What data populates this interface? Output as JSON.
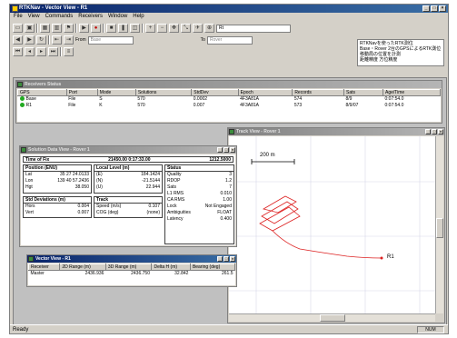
{
  "app": {
    "title": "RTKNav - Vector View - R1",
    "menu": [
      "File",
      "View",
      "Commands",
      "Receivers",
      "Window",
      "Help"
    ],
    "tb_combo": "Rt",
    "from_label": "From",
    "from_value": "Base",
    "to_label": "To",
    "to_value": "Rover",
    "memo_lines": [
      "RTKNavを使ったRTK測位",
      "Base・Rover 2台のGPSによるRTK測位",
      "移動局の位置を計測",
      "距離精度  方位精度"
    ],
    "status": "Ready",
    "status_right": "NUM"
  },
  "receivers": {
    "title": "Receivers Status",
    "columns": [
      "GPS",
      "Port",
      "Mode",
      "Solutions",
      "StdDev",
      "Epoch",
      "Records",
      "Sats",
      "Age/Time"
    ],
    "rows": [
      [
        "Base",
        "File",
        "S",
        "570",
        "0.0002",
        "4F3A81A",
        "574",
        "8/9",
        "0:07:54.0"
      ],
      [
        "R1",
        "File",
        "K",
        "570",
        "0.007",
        "4F3A81A",
        "573",
        "8/9/07",
        "0:07:54.0"
      ]
    ]
  },
  "solution": {
    "title": "Solution Data View - Rover 1",
    "header_left": "Time of Fix",
    "header_mid": "21450.00  0:17:33.00",
    "header_right": "1212.5000",
    "position_hd": "Position (ENU)",
    "local_hd": "Local Level (m)",
    "status_hd": "Status",
    "pos": [
      [
        "Lat",
        "35 27 24.0133"
      ],
      [
        "Lon",
        "139 40 57.2436"
      ],
      [
        "Hgt",
        "38.050"
      ]
    ],
    "local": [
      [
        "(E)",
        "184.1424"
      ],
      [
        "(N)",
        "-21.5144"
      ],
      [
        "(U)",
        "22.944"
      ]
    ],
    "status": [
      [
        "Quality",
        "3"
      ],
      [
        "RDOP",
        "1.2"
      ],
      [
        "Sats",
        "7"
      ],
      [
        "L1 RMS",
        "0.010"
      ],
      [
        "CA RMS",
        "1.00"
      ],
      [
        "Lock",
        "Not Engaged"
      ],
      [
        "Ambiguities",
        "FLOAT"
      ],
      [
        "Latency",
        "0.400"
      ]
    ],
    "std_hd": "Std Deviations (m)",
    "track_hd": "Track",
    "std": [
      [
        "Hors",
        "0.004"
      ],
      [
        "Vert",
        "0.007"
      ]
    ],
    "track": [
      [
        "Speed (m/s)",
        "0.107"
      ],
      [
        "COG (deg)",
        "(none)"
      ]
    ]
  },
  "vector": {
    "title": "Vector View - R1",
    "columns": [
      "Receiver",
      "2D Range (m)",
      "3D Range (m)",
      "Delta H (m)",
      "Bearing (deg)"
    ],
    "rows": [
      [
        "Master",
        "2436.936",
        "2436.750",
        "32.842",
        "261.5"
      ]
    ]
  },
  "track": {
    "title": "Track View - Rover 1",
    "scale_label": "200 m",
    "point_label": "R1",
    "colors": {
      "trace": "#dd2222",
      "grid": "#d8d8e8"
    }
  }
}
